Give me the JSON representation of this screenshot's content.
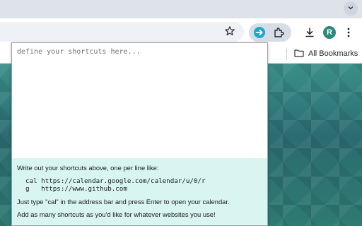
{
  "browser": {
    "avatar_initial": "R",
    "bookmarks_bar": {
      "all_bookmarks_label": "All Bookmarks"
    },
    "icons": [
      "star-icon",
      "goto-extension-icon",
      "puzzle-icon",
      "download-icon",
      "three-dots-menu-icon",
      "chevron-down-icon",
      "folder-icon"
    ],
    "colors": {
      "avatar": "#2c8a7a",
      "popup_help_bg": "#d8f5f1",
      "extension_icon": "#1aa7c9"
    }
  },
  "popup": {
    "textarea_placeholder": "define your shortcuts here...",
    "help_intro": "Write out your shortcuts above, one per line like:",
    "examples": [
      {
        "shortcut": "cal",
        "url": "https://calendar.google.com/calendar/u/0/r"
      },
      {
        "shortcut": "g",
        "url": "https://www.github.com"
      }
    ],
    "help_usage": "Just type \"cal\" in the address bar and press Enter to open your calendar.",
    "help_more": "Add as many shortcuts as you'd like for whatever websites you use!"
  }
}
